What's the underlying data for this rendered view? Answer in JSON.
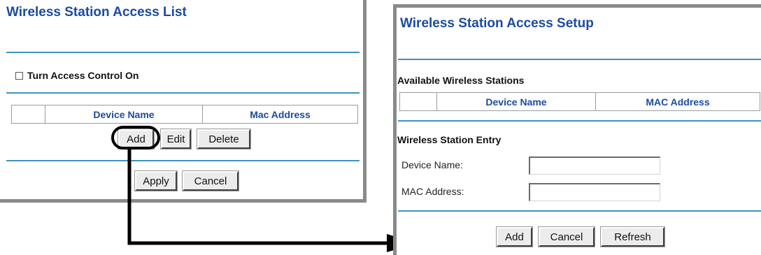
{
  "left_panel": {
    "title": "Wireless Station Access List",
    "access_control_label": "Turn Access Control On",
    "table_headers": [
      "",
      "Device Name",
      "Mac Address"
    ],
    "buttons": {
      "add": "Add",
      "edit": "Edit",
      "delete": "Delete",
      "apply": "Apply",
      "cancel": "Cancel"
    }
  },
  "right_panel": {
    "title": "Wireless Station Access Setup",
    "available_stations_label": "Available Wireless Stations",
    "table_headers": [
      "",
      "Device Name",
      "MAC Address"
    ],
    "entry_label": "Wireless Station Entry",
    "fields": {
      "device_name_label": "Device Name:",
      "device_name_value": "",
      "mac_address_label": "MAC Address:",
      "mac_address_value": ""
    },
    "buttons": {
      "add": "Add",
      "cancel": "Cancel",
      "refresh": "Refresh"
    }
  },
  "colors": {
    "title": "#1b4ba0",
    "rule": "#3e92c0",
    "panel_shadow": "#8a8a8a"
  },
  "icons": {
    "arrow": "callout-arrow-icon",
    "highlight": "highlight-oval"
  }
}
